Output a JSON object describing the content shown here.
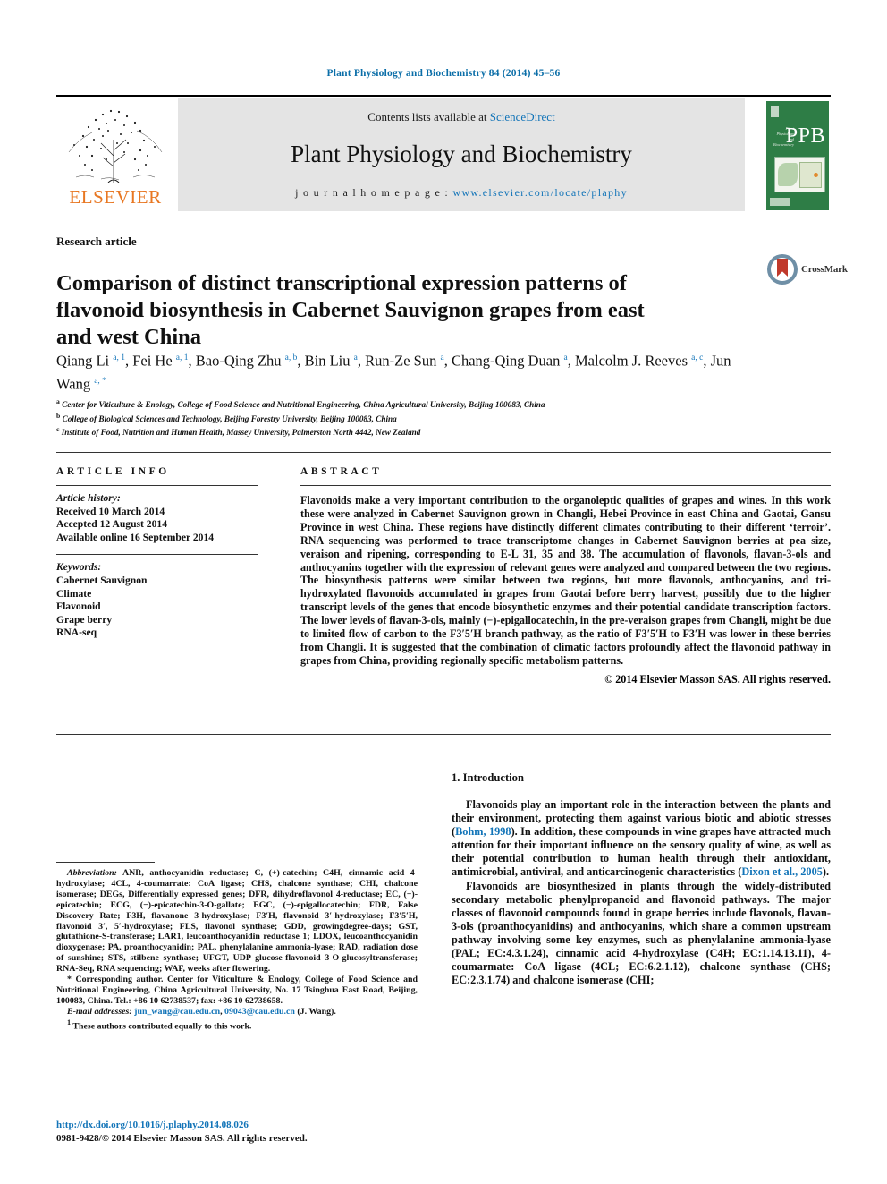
{
  "running_head": "Plant Physiology and Biochemistry 84 (2014) 45–56",
  "banner": {
    "contents_prefix": "Contents lists available at ",
    "sciencedirect": "ScienceDirect",
    "journal_title": "Plant Physiology and Biochemistry",
    "homepage_prefix": "j o u r n a l   h o m e p a g e :  ",
    "homepage_url": "www.elsevier.com/locate/plaphy",
    "elsevier_wordmark": "ELSEVIER",
    "cover_letters": "PPB",
    "cover_caption": "Plant Physiology and Biochemistry"
  },
  "article": {
    "type": "Research article",
    "title": "Comparison of distinct transcriptional expression patterns of flavonoid biosynthesis in Cabernet Sauvignon grapes from east and west China",
    "crossmark_label": "CrossMark"
  },
  "authors_html": "Qiang Li <sup>a, 1</sup>, Fei He <sup>a, 1</sup>, Bao-Qing Zhu <sup>a, b</sup>, Bin Liu <sup>a</sup>, Run-Ze Sun <sup>a</sup>, Chang-Qing Duan <sup>a</sup>, Malcolm J. Reeves <sup>a, c</sup>, Jun Wang <sup>a, *</sup>",
  "affiliations": [
    "Center for Viticulture & Enology, College of Food Science and Nutritional Engineering, China Agricultural University, Beijing 100083, China",
    "College of Biological Sciences and Technology, Beijing Forestry University, Beijing 100083, China",
    "Institute of Food, Nutrition and Human Health, Massey University, Palmerston North 4442, New Zealand"
  ],
  "article_info": {
    "heading": "ARTICLE INFO",
    "history_label": "Article history:",
    "history": [
      "Received 10 March 2014",
      "Accepted 12 August 2014",
      "Available online 16 September 2014"
    ],
    "keywords_label": "Keywords:",
    "keywords": [
      "Cabernet Sauvignon",
      "Climate",
      "Flavonoid",
      "Grape berry",
      "RNA-seq"
    ]
  },
  "abstract": {
    "heading": "ABSTRACT",
    "text": "Flavonoids make a very important contribution to the organoleptic qualities of grapes and wines. In this work these were analyzed in Cabernet Sauvignon grown in Changli, Hebei Province in east China and Gaotai, Gansu Province in west China. These regions have distinctly different climates contributing to their different ‘terroir’. RNA sequencing was performed to trace transcriptome changes in Cabernet Sauvignon berries at pea size, veraison and ripening, corresponding to E-L 31, 35 and 38. The accumulation of flavonols, flavan-3-ols and anthocyanins together with the expression of relevant genes were analyzed and compared between the two regions. The biosynthesis patterns were similar between two regions, but more flavonols, anthocyanins, and tri-hydroxylated flavonoids accumulated in grapes from Gaotai before berry harvest, possibly due to the higher transcript levels of the genes that encode biosynthetic enzymes and their potential candidate transcription factors. The lower levels of flavan-3-ols, mainly (−)-epigallocatechin, in the pre-veraison grapes from Changli, might be due to limited flow of carbon to the F3′5′H branch pathway, as the ratio of F3′5′H to F3′H was lower in these berries from Changli. It is suggested that the combination of climatic factors profoundly affect the flavonoid pathway in grapes from China, providing regionally specific metabolism patterns.",
    "copyright": "© 2014 Elsevier Masson SAS. All rights reserved."
  },
  "footnotes": {
    "abbreviation_label": "Abbreviation:",
    "abbreviation_text": " ANR, anthocyanidin reductase; C, (+)-catechin; C4H, cinnamic acid 4-hydroxylase; 4CL, 4-coumarrate: CoA ligase; CHS, chalcone synthase; CHI, chalcone isomerase; DEGs, Differentially expressed genes; DFR, dihydroflavonol 4-reductase; EC, (−)-epicatechin; ECG, (−)-epicatechin-3-O-gallate; EGC, (−)-epigallocatechin; FDR, False Discovery Rate; F3H, flavanone 3-hydroxylase; F3′H, flavonoid 3′-hydroxylase; F3′5′H, flavonoid 3′, 5′-hydroxylase; FLS, flavonol synthase; GDD, growingdegree-days; GST, glutathione-S-transferase; LAR1, leucoanthocyanidin reductase 1; LDOX, leucoanthocyanidin dioxygenase; PA, proanthocyanidin; PAL, phenylalanine ammonia-lyase; RAD, radiation dose of sunshine; STS, stilbene synthase; UFGT, UDP glucose-flavonoid 3-O-glucosyltransferase; RNA-Seq, RNA sequencing; WAF, weeks after flowering.",
    "corresponding_marker": "*",
    "corresponding_text": " Corresponding author. Center for Viticulture & Enology, College of Food Science and Nutritional Engineering, China Agricultural University, No. 17 Tsinghua East Road, Beijing, 100083, China. Tel.: +86 10 62738537; fax: +86 10 62738658.",
    "email_label": "E-mail addresses:",
    "email_1": "jun_wang@cau.edu.cn",
    "email_2": "09043@cau.edu.cn",
    "email_suffix": " (J. Wang).",
    "equal_marker": "1",
    "equal_text": " These authors contributed equally to this work.",
    "doi": "http://dx.doi.org/10.1016/j.plaphy.2014.08.026",
    "issn_line": "0981-9428/© 2014 Elsevier Masson SAS. All rights reserved."
  },
  "introduction": {
    "heading": "1. Introduction",
    "para1_a": "Flavonoids play an important role in the interaction between the plants and their environment, protecting them against various biotic and abiotic stresses (",
    "para1_ref1": "Bohm, 1998",
    "para1_b": "). In addition, these compounds in wine grapes have attracted much attention for their important influence on the sensory quality of wine, as well as their potential contribution to human health through their antioxidant, antimicrobial, antiviral, and anticarcinogenic characteristics (",
    "para1_ref2": "Dixon et al., 2005",
    "para1_c": ").",
    "para2": "Flavonoids are biosynthesized in plants through the widely-distributed secondary metabolic phenylpropanoid and flavonoid pathways. The major classes of flavonoid compounds found in grape berries include flavonols, flavan-3-ols (proanthocyanidins) and anthocyanins, which share a common upstream pathway involving some key enzymes, such as phenylalanine ammonia-lyase (PAL; EC:4.3.1.24), cinnamic acid 4-hydroxylase (C4H; EC:1.14.13.11), 4-coumarmate: CoA ligase (4CL; EC:6.2.1.12), chalcone synthase (CHS; EC:2.3.1.74) and chalcone isomerase (CHI;"
  },
  "colors": {
    "link": "#1274b8",
    "elsevier_orange": "#e87722",
    "journal_green": "#2e7d46",
    "banner_gray": "#e4e4e4"
  }
}
